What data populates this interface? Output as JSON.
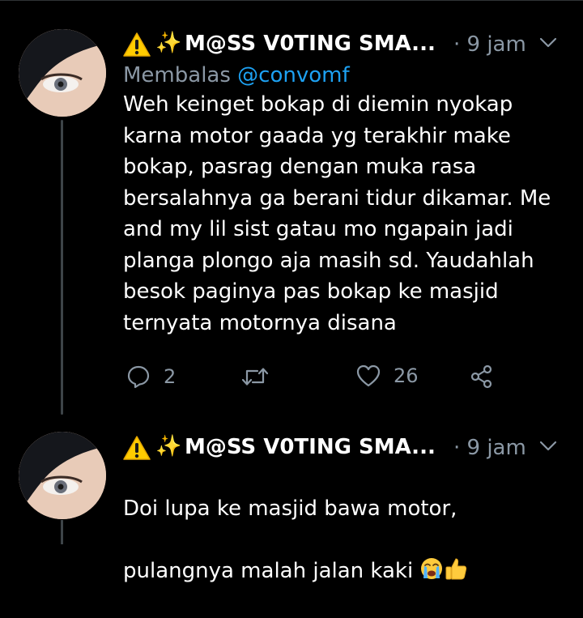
{
  "tweets": [
    {
      "display_name": "M@SS V0TING SMA...",
      "time": "· 9 jam",
      "replying_prefix": "Membalas ",
      "replying_handle": "@convomf",
      "text": "Weh keinget bokap di diemin nyokap karna motor gaada yg terakhir make bokap, pasrag dengan muka rasa bersalahnya ga berani tidur dikamar. Me and my lil sist gatau mo ngapain jadi planga plongo aja masih sd. Yaudahlah besok paginya pas bokap ke masjid ternyata motornya disana",
      "replies": "2",
      "retweets": "",
      "likes": "26"
    },
    {
      "display_name": "M@SS V0TING SMA...",
      "time": "· 9 jam",
      "text_line1": "Doi lupa ke masjid bawa motor,",
      "text_line2": "pulangnya malah jalan kaki "
    }
  ],
  "icons": {
    "warning": "warning-icon",
    "sparkles": "sparkles-icon",
    "chevron": "chevron-down-icon",
    "reply": "reply-icon",
    "retweet": "retweet-icon",
    "like": "heart-icon",
    "share": "share-icon",
    "emoji_cry": "loudly-crying-face-emoji",
    "emoji_thumb": "thumbs-up-emoji"
  },
  "colors": {
    "background": "#000000",
    "text": "#ffffff",
    "muted": "#8b98a5",
    "link": "#1da1f2",
    "warning": "#ffcc00"
  }
}
